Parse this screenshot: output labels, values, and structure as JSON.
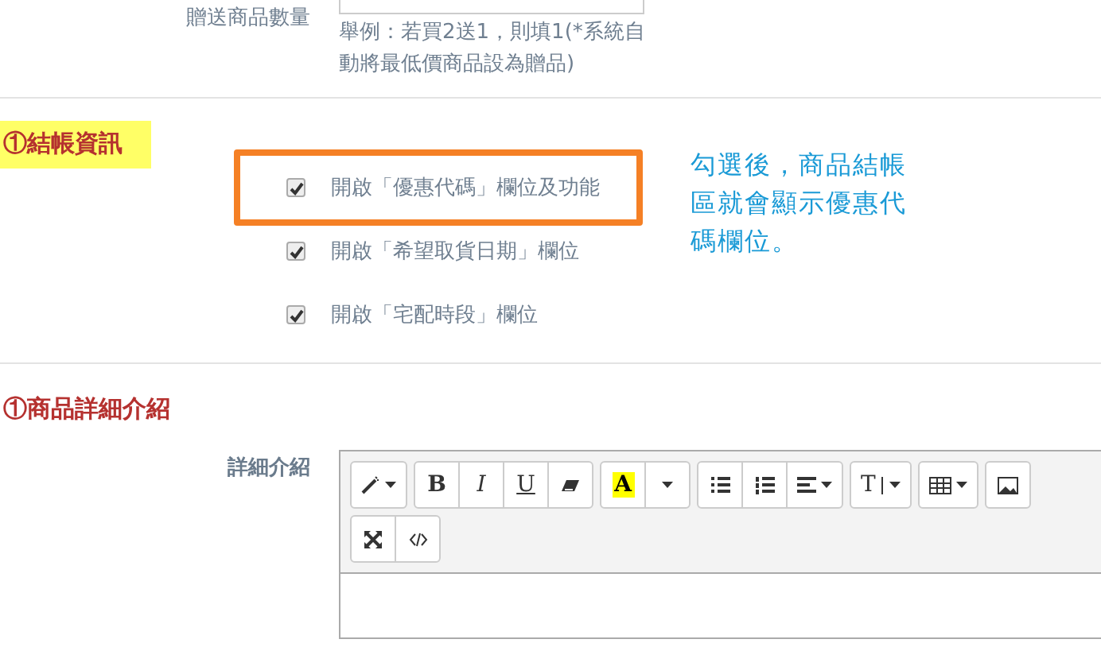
{
  "top_field": {
    "label": "贈送商品數量",
    "hint": "舉例：若買2送1，則填1(*系統自動將最低價商品設為贈品)"
  },
  "checkout": {
    "heading": "①結帳資訊",
    "highlighted": true,
    "options": [
      {
        "label": "開啟「優惠代碼」欄位及功能",
        "checked": true,
        "outlined": true
      },
      {
        "label": "開啟「希望取貨日期」欄位",
        "checked": true,
        "outlined": false
      },
      {
        "label": "開啟「宅配時段」欄位",
        "checked": true,
        "outlined": false
      }
    ],
    "callout": "勾選後，商品結帳區就會顯示優惠代碼欄位。"
  },
  "details": {
    "heading": "①商品詳細介紹",
    "highlighted": false,
    "label": "詳細介紹",
    "toolbar": [
      [
        {
          "kind": "magic"
        }
      ],
      [
        {
          "kind": "bold",
          "label": "B"
        },
        {
          "kind": "italic",
          "label": "I"
        },
        {
          "kind": "underline",
          "label": "U"
        },
        {
          "kind": "eraser"
        }
      ],
      [
        {
          "kind": "color",
          "label": "A"
        },
        {
          "kind": "caret"
        }
      ],
      [
        {
          "kind": "ul"
        },
        {
          "kind": "ol"
        },
        {
          "kind": "align"
        }
      ],
      [
        {
          "kind": "fontsize",
          "label": "T"
        }
      ],
      [
        {
          "kind": "table"
        }
      ],
      [
        {
          "kind": "picture"
        }
      ],
      [
        {
          "kind": "fullscreen"
        },
        {
          "kind": "code"
        }
      ]
    ]
  }
}
